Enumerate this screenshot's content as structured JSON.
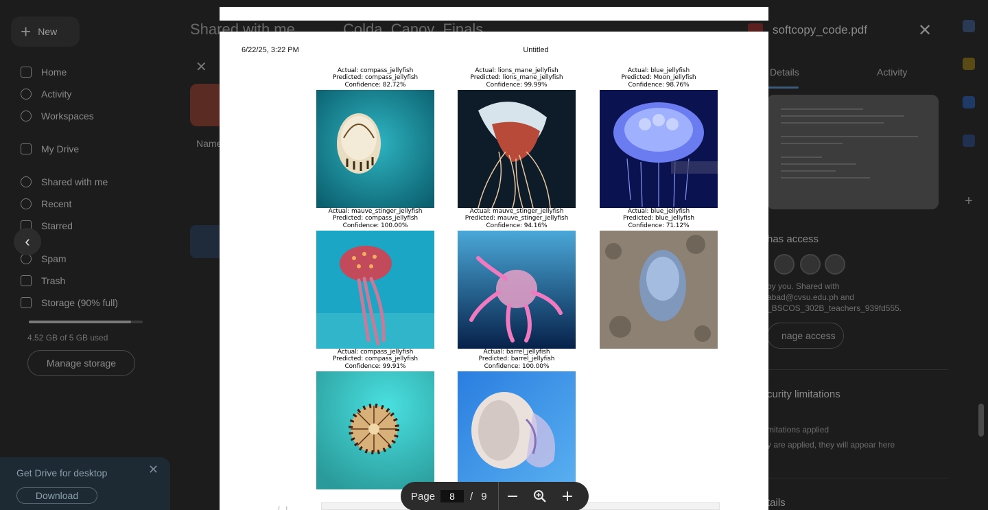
{
  "sidebar": {
    "new_label": "New",
    "items": [
      {
        "label": "Home"
      },
      {
        "label": "Activity"
      },
      {
        "label": "Workspaces"
      },
      {
        "label": "My Drive"
      },
      {
        "label": "Shared with me"
      },
      {
        "label": "Recent"
      },
      {
        "label": "Starred"
      },
      {
        "label": "Spam"
      },
      {
        "label": "Trash"
      },
      {
        "label": "Storage (90% full)"
      }
    ],
    "storage_used": "4.52 GB of 5 GB used",
    "storage_fraction": 0.9,
    "manage_storage": "Manage storage",
    "desktop_title": "Get Drive for desktop",
    "download_label": "Download"
  },
  "main": {
    "breadcrumb_root": "Shared with me",
    "breadcrumb_folder": "Colda_Canoy_Finals",
    "name_column": "Name"
  },
  "details": {
    "file_name": "softcopy_code.pdf",
    "tab_details": "Details",
    "tab_activity": "Activity",
    "access_heading": "has access",
    "access_line1": "by you. Shared with",
    "access_line2": "abad@cvsu.edu.ph and",
    "access_line3": "_BSCOS_302B_teachers_939fd555.",
    "manage_access": "nage access",
    "security_heading": "curity limitations",
    "security_line1": "mitations applied",
    "security_line2": "y are applied, they will appear here",
    "details_heading": "tails"
  },
  "pdf": {
    "header_date": "6/22/25, 3:22 PM",
    "header_title": "Untitled",
    "results": [
      {
        "actual": "Actual: compass_jellyfish",
        "predicted": "Predicted: compass_jellyfish",
        "confidence": "Confidence: 82.72%"
      },
      {
        "actual": "Actual: lions_mane_jellyfish",
        "predicted": "Predicted: lions_mane_jellyfish",
        "confidence": "Confidence: 99.99%"
      },
      {
        "actual": "Actual: blue_jellyfish",
        "predicted": "Predicted: Moon_jellyfish",
        "confidence": "Confidence: 98.76%"
      },
      {
        "actual": "Actual: mauve_stinger_jellyfish",
        "predicted": "Predicted: compass_jellyfish",
        "confidence": "Confidence: 100.00%"
      },
      {
        "actual": "Actual: mauve_stinger_jellyfish",
        "predicted": "Predicted: mauve_stinger_jellyfish",
        "confidence": "Confidence: 94.16%"
      },
      {
        "actual": "Actual: blue_jellyfish",
        "predicted": "Predicted: blue_jellyfish",
        "confidence": "Confidence: 71.12%"
      },
      {
        "actual": "Actual: compass_jellyfish",
        "predicted": "Predicted: compass_jellyfish",
        "confidence": "Confidence: 99.91%"
      },
      {
        "actual": "Actual: barrel_jellyfish",
        "predicted": "Predicted: barrel_jellyfish",
        "confidence": "Confidence: 100.00%"
      }
    ]
  },
  "controls": {
    "page_label": "Page",
    "current_page": "8",
    "separator": "/",
    "total_pages": "9"
  }
}
